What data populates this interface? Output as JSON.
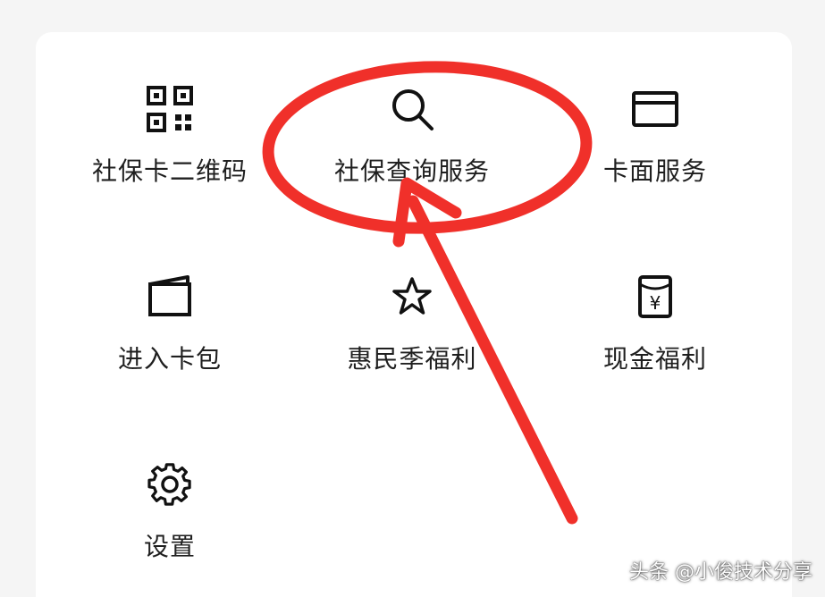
{
  "menu": {
    "items": [
      {
        "label": "社保卡二维码",
        "icon": "qr-code-icon"
      },
      {
        "label": "社保查询服务",
        "icon": "search-icon"
      },
      {
        "label": "卡面服务",
        "icon": "card-icon"
      },
      {
        "label": "进入卡包",
        "icon": "wallet-icon"
      },
      {
        "label": "惠民季福利",
        "icon": "star-icon"
      },
      {
        "label": "现金福利",
        "icon": "red-envelope-yuan-icon"
      },
      {
        "label": "设置",
        "icon": "gear-icon"
      }
    ]
  },
  "annotation": {
    "color": "#f0302a"
  },
  "watermark": {
    "text": "头条 @小俊技术分享"
  }
}
